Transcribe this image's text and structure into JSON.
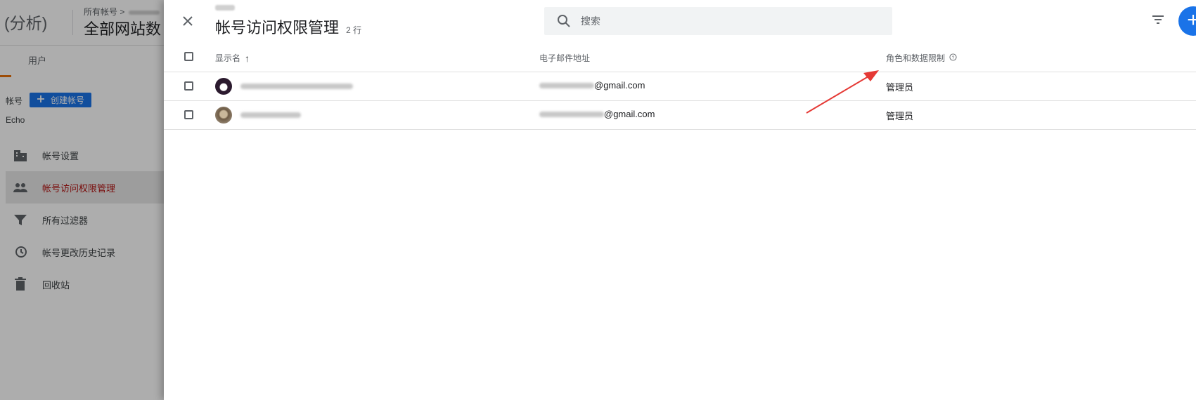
{
  "background": {
    "app_name": "(分析)",
    "breadcrumb": "所有帐号 >",
    "page_title": "全部网站数",
    "tab_users": "用户",
    "account_label": "帐号",
    "create_account_button": "创建帐号",
    "account_name": "Echo",
    "menu": [
      {
        "label": "帐号设置",
        "icon": "building-icon"
      },
      {
        "label": "帐号访问权限管理",
        "icon": "people-icon"
      },
      {
        "label": "所有过滤器",
        "icon": "filter-icon"
      },
      {
        "label": "帐号更改历史记录",
        "icon": "history-icon"
      },
      {
        "label": "回收站",
        "icon": "trash-icon"
      }
    ]
  },
  "panel": {
    "title": "帐号访问权限管理",
    "row_count": "2 行",
    "search_placeholder": "搜索",
    "add_button": "+"
  },
  "table": {
    "columns": {
      "name": "显示名",
      "sort_indicator": "↑",
      "email": "电子邮件地址",
      "role": "角色和数据限制"
    },
    "rows": [
      {
        "email_suffix": "@gmail.com",
        "role": "管理员"
      },
      {
        "email_suffix": "@gmail.com",
        "role": "管理员"
      }
    ]
  },
  "colors": {
    "accent": "#1a73e8",
    "active_menu_text": "#b31412",
    "annotation_arrow": "#e53935"
  }
}
